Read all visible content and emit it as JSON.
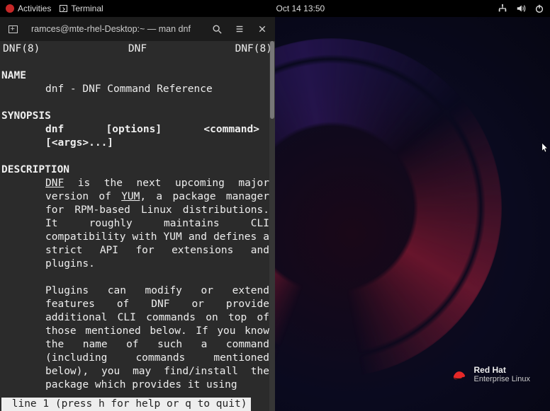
{
  "topbar": {
    "activities_label": "Activities",
    "terminal_label": "Terminal",
    "datetime": "Oct 14  13:50"
  },
  "window": {
    "title": "ramces@mte-rhel-Desktop:~ — man dnf"
  },
  "man": {
    "header_left": "DNF(8)",
    "header_center": "DNF",
    "header_right": "DNF(8)",
    "section_name": "NAME",
    "name_line": "dnf - DNF Command Reference",
    "section_synopsis": "SYNOPSIS",
    "synopsis_line1_cmd": "dnf",
    "synopsis_line1_opts": "[options]",
    "synopsis_line1_cmd2": "<command>",
    "synopsis_line2": "[<args>...]",
    "section_description": "DESCRIPTION",
    "desc_dnf": "DNF",
    "desc_p1a": " is the next  upcoming  major version  of  ",
    "desc_yum": "YUM",
    "desc_p1b": ", a package manager for RPM-based Linux distributions.  It  roughly  maintains CLI compatibility with  YUM  and defines  a strict API for extensions and plugins.",
    "desc_p2": "Plugins  can  modify  or  extend features of DNF or provide additional CLI commands  on  top  of those  mentioned  below.  If you know the name of such a  command (including   commands  mentioned below), you may find/install the package  which provides it using",
    "status": " line 1 (press h for help or q to quit)"
  },
  "branding": {
    "line1": "Red Hat",
    "line2": "Enterprise Linux"
  }
}
